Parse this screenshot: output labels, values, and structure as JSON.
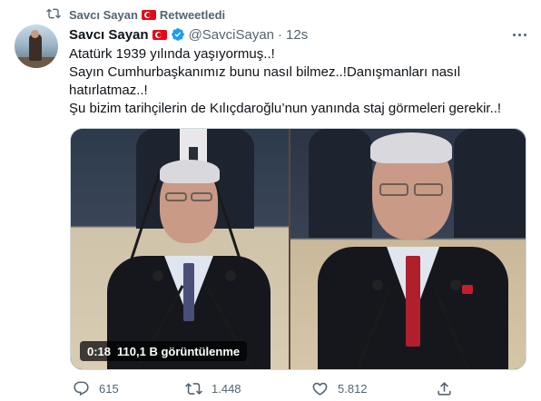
{
  "retweet": {
    "user": "Savcı Sayan",
    "label": "Retweetledi"
  },
  "tweet": {
    "display_name": "Savcı Sayan",
    "handle": "@SavciSayan",
    "separator": "·",
    "time": "12s",
    "lines": [
      "Atatürk 1939 yılında yaşıyormuş..!",
      "Sayın Cumhurbaşkanımız bunu nasıl bilmez..!Danışmanları nasıl",
      "hatırlatmaz..!",
      "Şu bizim tarihçilerin de Kılıçdaroğlu’nun yanında staj görmeleri gerekir..!"
    ]
  },
  "video": {
    "duration": "0:18",
    "views": "110,1 B görüntülenme"
  },
  "actions": {
    "reply_count": "615",
    "retweet_count": "1.448",
    "like_count": "5.812"
  },
  "colors": {
    "accent": "#1d9bf0",
    "muted": "#536471",
    "flag_red": "#e30a17"
  }
}
